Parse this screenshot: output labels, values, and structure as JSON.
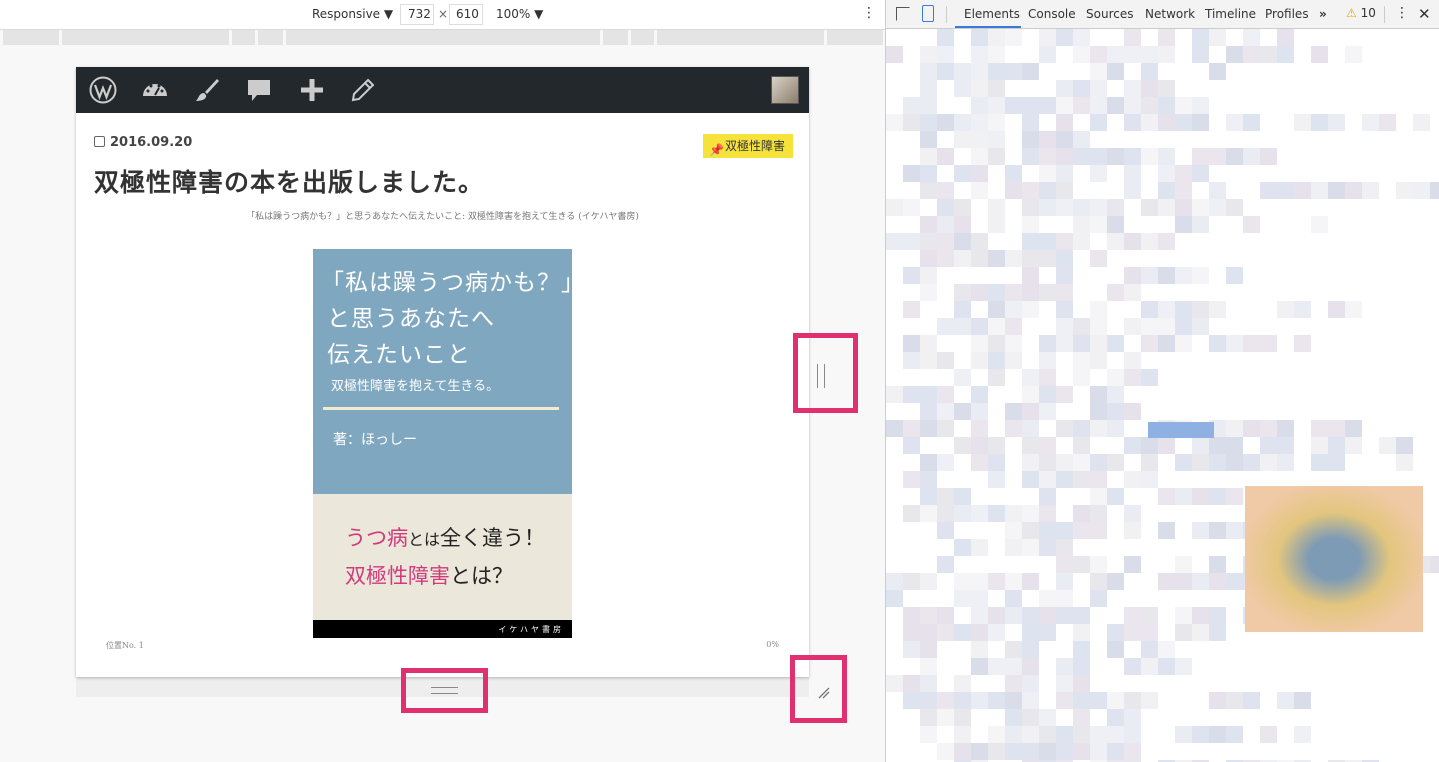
{
  "device_toolbar": {
    "mode": "Responsive ▼",
    "width": "732",
    "times": "×",
    "height": "610",
    "zoom": "100% ▼",
    "menu": "⋮"
  },
  "wp_admin_bar": {
    "icons": [
      "wordpress-icon",
      "dashboard-icon",
      "brush-icon",
      "comment-icon",
      "plus-icon",
      "pencil-icon"
    ]
  },
  "post": {
    "date": "2016.09.20",
    "category": "双極性障害",
    "title": "双極性障害の本を出版しました。",
    "subtitle": "「私は躁うつ病かも？」と思うあなたへ伝えたいこと: 双極性障害を抱えて生きる (イケハヤ書房)"
  },
  "book_cover": {
    "line1": "「私は躁うつ病かも？」",
    "line2": "と思うあなたへ",
    "line3": "伝えたいこと",
    "subline": "双極性障害を抱えて生きる。",
    "author": "著：ほっしー",
    "tag1_a": "うつ病",
    "tag1_b": "とは",
    "tag1_c": "全く違う！",
    "tag2_a": "双極性障害",
    "tag2_b": "とは？",
    "publisher": "イケハヤ書房"
  },
  "reader": {
    "location": "位置No. 1",
    "percent": "0%"
  },
  "devtools": {
    "tabs": [
      "Elements",
      "Console",
      "Sources",
      "Network",
      "Timeline",
      "Profiles"
    ],
    "more": "»",
    "warnings": "10",
    "menu": "⋮",
    "close": "✕"
  },
  "colors": {
    "highlight": "#e0306f",
    "wp_bar": "#23282d",
    "category_badge": "#f5e23b",
    "cover_blue": "#7fa7c0",
    "cover_pink": "#d03b7b",
    "tab_accent": "#3879d9"
  }
}
